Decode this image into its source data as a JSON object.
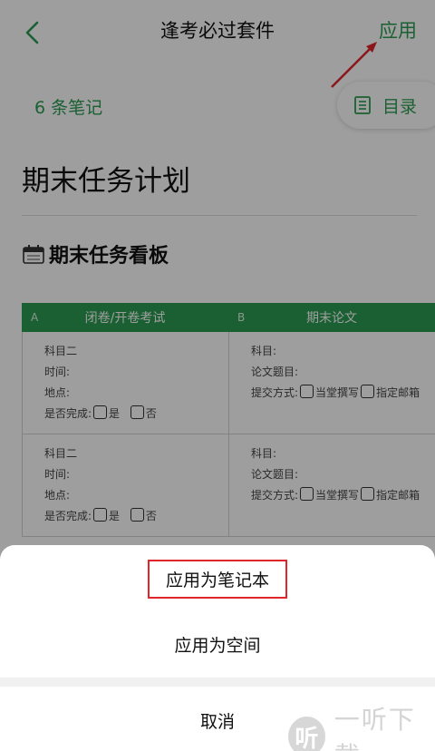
{
  "header": {
    "title": "逢考必过套件",
    "apply_label": "应用"
  },
  "notes": {
    "count_label": "6 条笔记",
    "toc_label": "目录"
  },
  "document": {
    "title": "期末任务计划",
    "board_title": "期末任务看板"
  },
  "board": {
    "columns": [
      {
        "letter": "A",
        "label": "闭卷/开卷考试"
      },
      {
        "letter": "B",
        "label": "期末论文"
      }
    ],
    "rows": [
      {
        "a": {
          "subject": "科目二",
          "time": "时间:",
          "place": "地点:",
          "done": "是否完成:",
          "yes": "是",
          "no": "否"
        },
        "b": {
          "subject": "科目:",
          "topic": "论文题目:",
          "submit": "提交方式:",
          "opt1": "当堂撰写",
          "opt2": "指定邮箱"
        }
      },
      {
        "a": {
          "subject": "科目二",
          "time": "时间:",
          "place": "地点:",
          "done": "是否完成:",
          "yes": "是",
          "no": "否"
        },
        "b": {
          "subject": "科目:",
          "topic": "论文题目:",
          "submit": "提交方式:",
          "opt1": "当堂撰写",
          "opt2": "指定邮箱"
        }
      }
    ]
  },
  "sheet": {
    "apply_notebook": "应用为笔记本",
    "apply_space": "应用为空间",
    "cancel": "取消"
  },
  "watermark": {
    "glyph": "听",
    "text": "一听下载"
  },
  "colors": {
    "accent": "#2c9c53",
    "highlight": "#e0262a"
  }
}
